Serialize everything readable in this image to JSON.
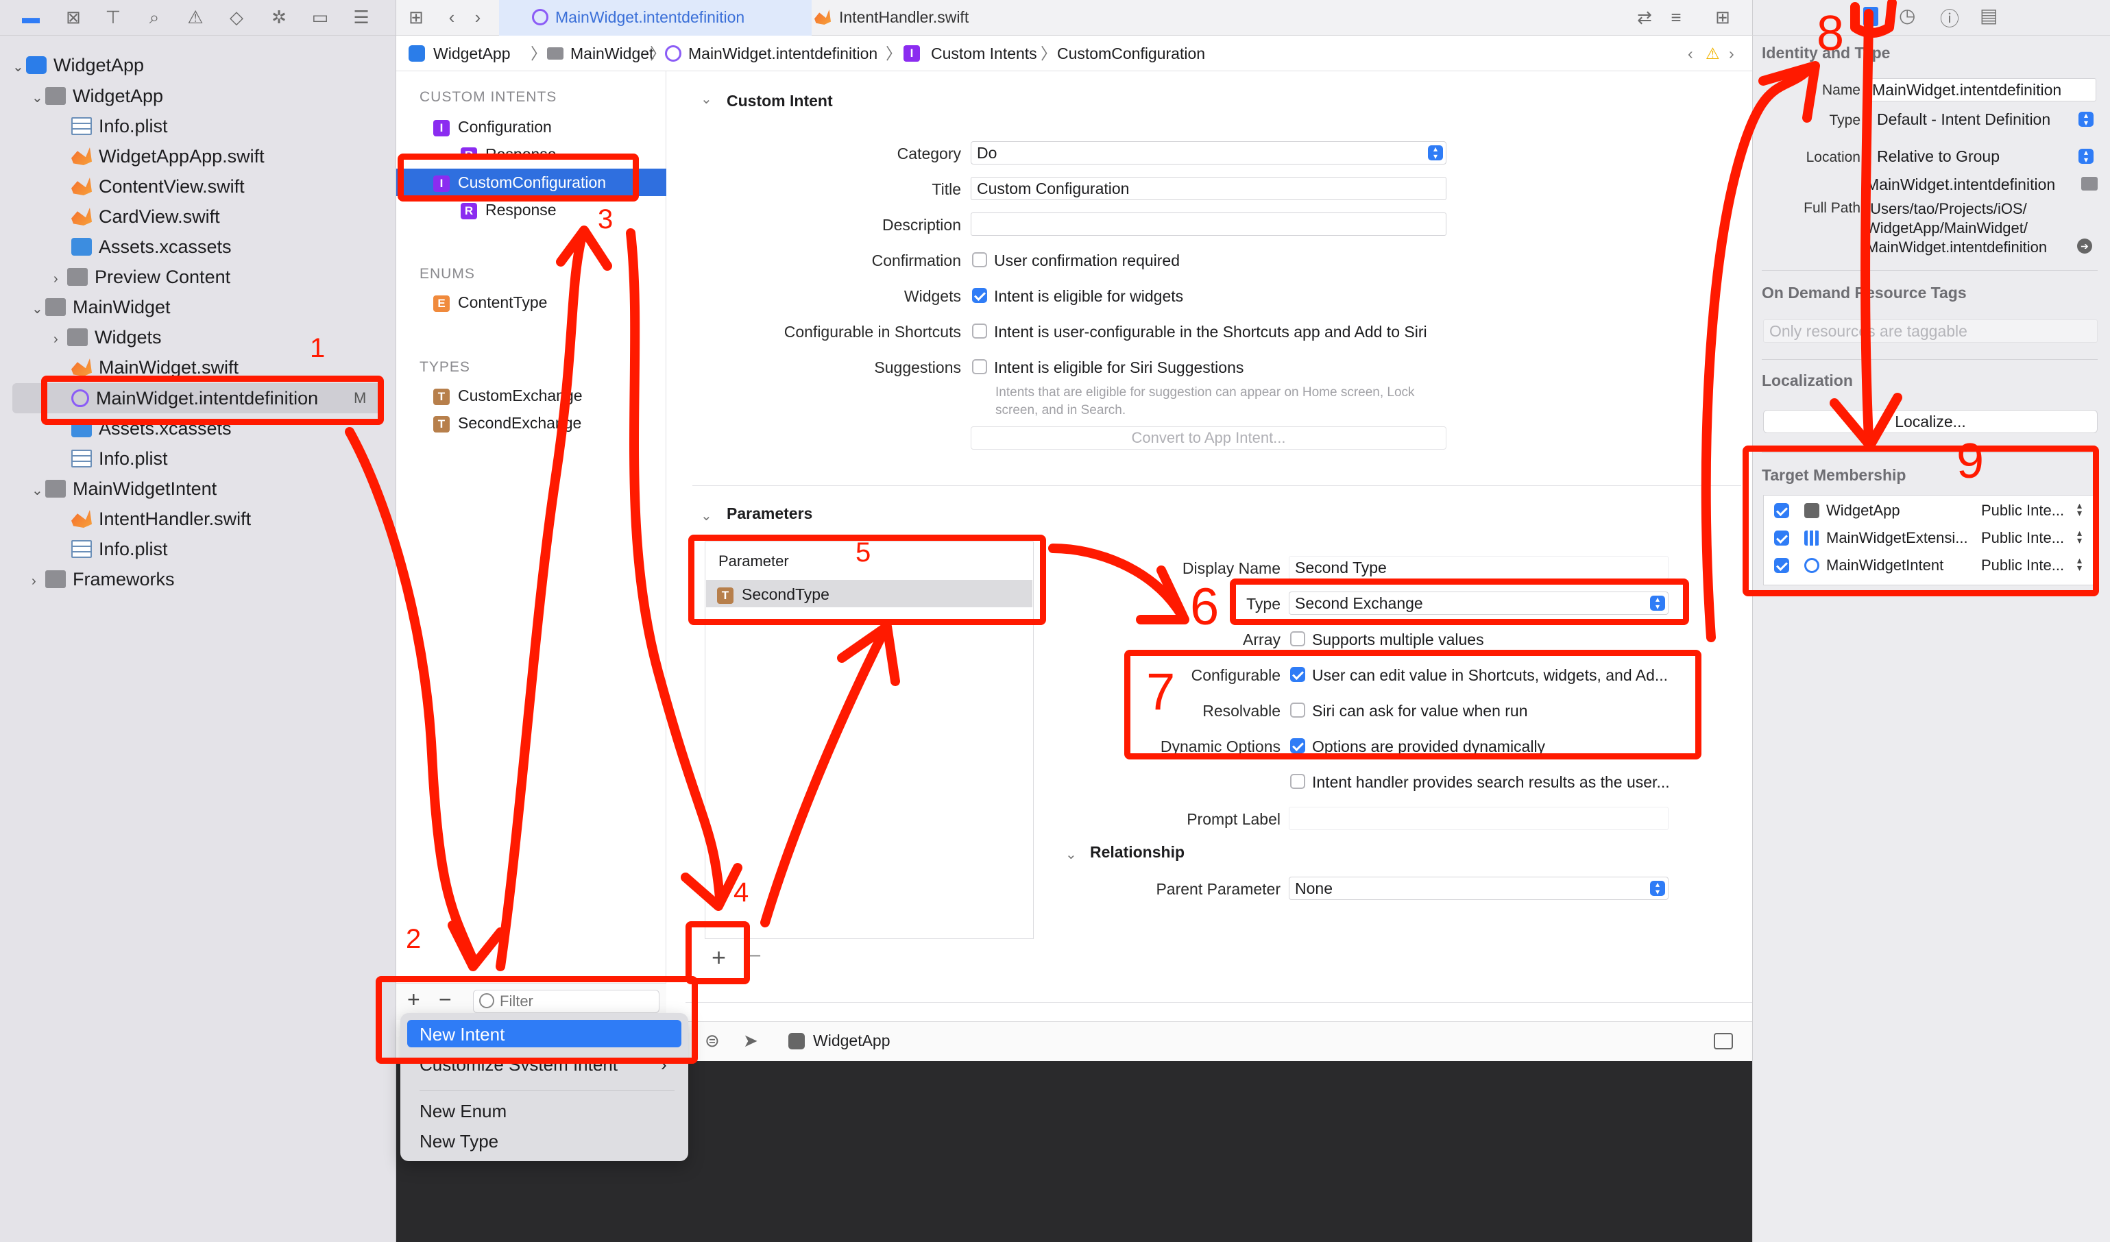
{
  "navigator": {
    "items": [
      {
        "label": "WidgetApp",
        "icon": "xcode-project-icon",
        "level": 0,
        "expanded": true
      },
      {
        "label": "WidgetApp",
        "icon": "folder-icon",
        "level": 1,
        "expanded": true
      },
      {
        "label": "Info.plist",
        "icon": "plist-icon",
        "level": 2
      },
      {
        "label": "WidgetAppApp.swift",
        "icon": "swift-icon",
        "level": 2
      },
      {
        "label": "ContentView.swift",
        "icon": "swift-icon",
        "level": 2
      },
      {
        "label": "CardView.swift",
        "icon": "swift-icon",
        "level": 2
      },
      {
        "label": "Assets.xcassets",
        "icon": "assets-icon",
        "level": 2
      },
      {
        "label": "Preview Content",
        "icon": "folder-icon",
        "level": 2,
        "collapsed": true
      },
      {
        "label": "MainWidget",
        "icon": "folder-icon",
        "level": 1,
        "expanded": true
      },
      {
        "label": "Widgets",
        "icon": "folder-icon",
        "level": 2,
        "collapsed": true
      },
      {
        "label": "MainWidget.swift",
        "icon": "swift-icon",
        "level": 2
      },
      {
        "label": "MainWidget.intentdefinition",
        "icon": "intent-definition-icon",
        "level": 2,
        "selected": true,
        "badge": "M"
      },
      {
        "label": "Assets.xcassets",
        "icon": "assets-icon",
        "level": 2
      },
      {
        "label": "Info.plist",
        "icon": "plist-icon",
        "level": 2
      },
      {
        "label": "MainWidgetIntent",
        "icon": "folder-icon",
        "level": 1,
        "expanded": true
      },
      {
        "label": "IntentHandler.swift",
        "icon": "swift-icon",
        "level": 2
      },
      {
        "label": "Info.plist",
        "icon": "plist-icon",
        "level": 2
      },
      {
        "label": "Frameworks",
        "icon": "folder-icon",
        "level": 1,
        "collapsed": true
      }
    ]
  },
  "tabs": [
    {
      "label": "MainWidget.intentdefinition",
      "active": true
    },
    {
      "label": "IntentHandler.swift",
      "active": false
    }
  ],
  "breadcrumb": [
    "WidgetApp",
    "MainWidget",
    "MainWidget.intentdefinition",
    "Custom Intents",
    "CustomConfiguration"
  ],
  "outline": {
    "custom_intents_header": "CUSTOM INTENTS",
    "intents": [
      {
        "label": "Configuration",
        "badge": "I"
      },
      {
        "label": "Response",
        "badge": "R"
      },
      {
        "label": "CustomConfiguration",
        "badge": "I",
        "selected": true
      },
      {
        "label": "Response",
        "badge": "R"
      }
    ],
    "enums_header": "ENUMS",
    "enums": [
      {
        "label": "ContentType",
        "badge": "E"
      }
    ],
    "types_header": "TYPES",
    "types": [
      {
        "label": "CustomExchange",
        "badge": "T"
      },
      {
        "label": "SecondExchange",
        "badge": "T"
      }
    ],
    "filter_placeholder": "Filter"
  },
  "custom_intent": {
    "header": "Custom Intent",
    "category_label": "Category",
    "category_value": "Do",
    "title_label": "Title",
    "title_value": "Custom Configuration",
    "description_label": "Description",
    "confirmation_label": "Confirmation",
    "confirmation_text": "User confirmation required",
    "widgets_label": "Widgets",
    "widgets_text": "Intent is eligible for widgets",
    "shortcuts_label": "Configurable in Shortcuts",
    "shortcuts_text": "Intent is user-configurable in the Shortcuts app and Add to Siri",
    "suggestions_label": "Suggestions",
    "suggestions_text": "Intent is eligible for Siri Suggestions",
    "suggestions_note": "Intents that are eligible for suggestion can appear on Home screen, Lock screen, and in Search.",
    "convert_button": "Convert to App Intent..."
  },
  "parameters": {
    "header": "Parameters",
    "list_header": "Parameter",
    "items": [
      {
        "label": "SecondType",
        "badge": "T"
      }
    ],
    "display_name_label": "Display Name",
    "display_name_value": "Second Type",
    "type_label": "Type",
    "type_value": "Second Exchange",
    "array_label": "Array",
    "array_text": "Supports multiple values",
    "configurable_label": "Configurable",
    "configurable_text": "User can edit value in Shortcuts, widgets, and Ad...",
    "resolvable_label": "Resolvable",
    "resolvable_text": "Siri can ask for value when run",
    "dynamic_label": "Dynamic Options",
    "dynamic_text": "Options are provided dynamically",
    "search_text": "Intent handler provides search results as the user...",
    "prompt_label": "Prompt Label",
    "relationship_header": "Relationship",
    "parent_label": "Parent Parameter",
    "parent_value": "None"
  },
  "debug_bar": {
    "scheme": "WidgetApp"
  },
  "context_menu": {
    "items": [
      "New Intent",
      "Customize System Intent",
      "New Enum",
      "New Type"
    ]
  },
  "inspector": {
    "identity_header": "Identity and Type",
    "name_label": "Name",
    "name_value": "MainWidget.intentdefinition",
    "type_label": "Type",
    "type_value": "Default - Intent Definition",
    "location_label": "Location",
    "location_value": "Relative to Group",
    "location_file": "MainWidget.intentdefinition",
    "full_path_label": "Full Path",
    "full_path_value": [
      "/Users/tao/Projects/iOS/",
      "WidgetApp/MainWidget/",
      "MainWidget.intentdefinition"
    ],
    "odr_header": "On Demand Resource Tags",
    "odr_placeholder": "Only resources are taggable",
    "localization_header": "Localization",
    "localize_button": "Localize...",
    "target_header": "Target Membership",
    "targets": [
      {
        "name": "WidgetApp",
        "access": "Public Inte..."
      },
      {
        "name": "MainWidgetExtensi...",
        "access": "Public Inte..."
      },
      {
        "name": "MainWidgetIntent",
        "access": "Public Inte..."
      }
    ]
  },
  "annotations": [
    "1",
    "2",
    "3",
    "4",
    "5",
    "6",
    "7",
    "8",
    "9"
  ],
  "annotation_color": "#ff1a00",
  "accent_color": "#2f7cf6"
}
